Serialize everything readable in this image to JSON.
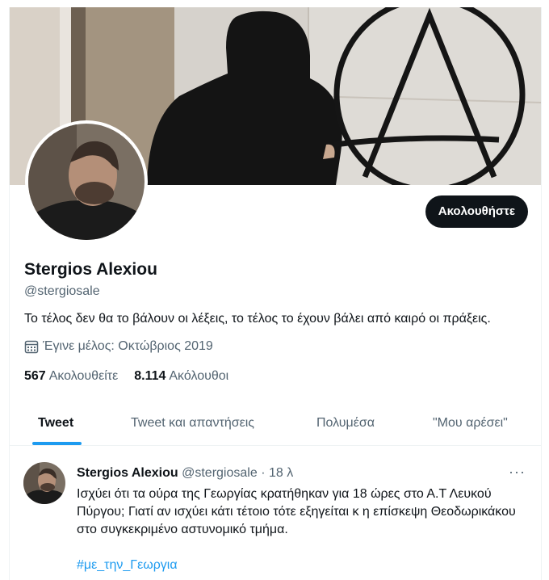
{
  "profile": {
    "name": "Stergios Alexiou",
    "handle": "@stergiosale",
    "bio": "Το τέλος δεν θα το βάλουν οι λέξεις, το τέλος το έχουν βάλει από καιρό οι πράξεις.",
    "joined": "Έγινε μέλος: Οκτώβριος 2019",
    "following_count": "567",
    "following_label": "Ακολουθείτε",
    "followers_count": "8.114",
    "followers_label": "Ακόλουθοι",
    "follow_button": "Ακολουθήστε"
  },
  "tabs": [
    {
      "label": "Tweet",
      "active": true
    },
    {
      "label": "Tweet και απαντήσεις",
      "active": false
    },
    {
      "label": "Πολυμέσα",
      "active": false
    },
    {
      "label": "\"Μου αρέσει\"",
      "active": false
    }
  ],
  "tweet": {
    "name": "Stergios Alexiou",
    "handle": "@stergiosale",
    "separator": "·",
    "time": "18 λ",
    "text": "Ισχύει ότι τα ούρα της Γεωργίας κρατήθηκαν για 18 ώρες στο Α.Τ Λευκού Πύργου; Γιατί αν ισχύει κάτι τέτοιο τότε εξηγείται κ η επίσκεψη Θεοδωρικάκου στο συγκεκριμένο αστυνομικό τμήμα.",
    "hashtag": "#με_την_Γεωργια",
    "more": "···"
  },
  "icons": {
    "calendar": "calendar-icon",
    "more": "more-icon"
  },
  "colors": {
    "accent": "#1d9bf0",
    "text": "#0f1419",
    "secondary": "#536471",
    "button": "#0f1419"
  }
}
